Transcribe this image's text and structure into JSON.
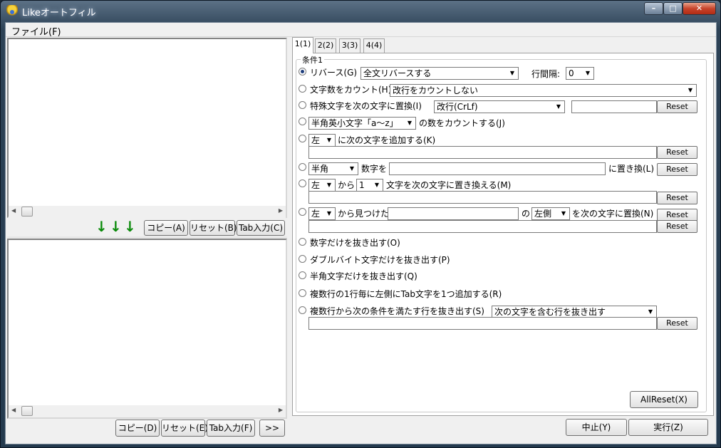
{
  "window": {
    "title": "Likeオートフィル"
  },
  "menu": {
    "file": "ファイル(F)"
  },
  "top_panel": {
    "copy": "コピー(A)",
    "reset": "リセット(B)",
    "tab_input": "Tab入力(C)",
    "arrows": [
      "↓",
      "↓",
      "↓"
    ]
  },
  "bottom_panel": {
    "copy": "コピー(D)",
    "reset": "リセット(E)",
    "tab_input": "Tab入力(F)",
    "more": ">>"
  },
  "tabs": [
    "1(1)",
    "2(2)",
    "3(3)",
    "4(4)"
  ],
  "group_label": "条件1",
  "conditions": {
    "c1": {
      "label": "リバース(G)",
      "combo": "全文リバースする",
      "interval_label": "行間隔:",
      "interval_value": "0"
    },
    "c2": {
      "label": "文字数をカウント(H)",
      "combo": "改行をカウントしない"
    },
    "c3": {
      "label": "特殊文字を次の文字に置換(I)",
      "combo": "改行(CrLf)",
      "reset": "Reset"
    },
    "c4": {
      "combo": "半角英小文字「a～z」",
      "suffix": "の数をカウントする(J)"
    },
    "c5": {
      "combo": "左",
      "suffix": "に次の文字を追加する(K)",
      "reset": "Reset"
    },
    "c6": {
      "combo": "半角",
      "mid": "数字を",
      "suffix": "に置き換(L)",
      "reset": "Reset"
    },
    "c7": {
      "combo": "左",
      "mid1": "から",
      "combo2": "1",
      "suffix": "文字を次の文字に置き換える(M)",
      "reset": "Reset"
    },
    "c8": {
      "combo": "左",
      "mid1": "から見つけた",
      "mid2": "の",
      "combo2": "左側",
      "suffix": "を次の文字に置換(N)",
      "reset1": "Reset",
      "reset2": "Reset"
    },
    "c9": {
      "label": "数字だけを抜き出す(O)"
    },
    "c10": {
      "label": "ダブルバイト文字だけを抜き出す(P)"
    },
    "c11": {
      "label": "半角文字だけを抜き出す(Q)"
    },
    "c12": {
      "label": "複数行の1行毎に左側にTab文字を1つ追加する(R)"
    },
    "c13": {
      "label": "複数行から次の条件を満たす行を抜き出す(S)",
      "combo": "次の文字を含む行を抜き出す",
      "reset": "Reset"
    }
  },
  "all_reset": "AllReset(X)",
  "footer": {
    "stop": "中止(Y)",
    "run": "実行(Z)"
  }
}
